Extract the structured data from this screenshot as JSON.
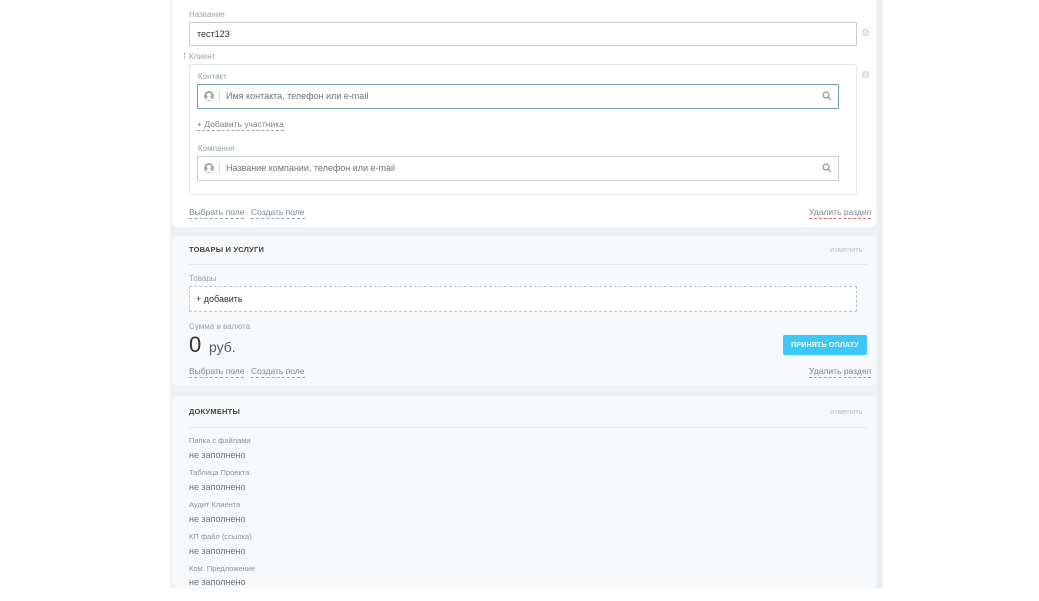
{
  "fields": {
    "name_label": "Название",
    "name_value": "тест123",
    "client_label": "Клиент",
    "contact_label": "Контакт",
    "contact_placeholder": "Имя контакта, телефон или e-mail",
    "add_participant": "+ Добавить участника",
    "company_label": "Компания",
    "company_placeholder": "Название компании, телефон или e-mail"
  },
  "section1_footer": {
    "choose_field": "Выбрать поле",
    "create_field": "Создать поле",
    "delete_section": "Удалить раздел"
  },
  "products": {
    "title": "ТОВАРЫ И УСЛУГИ",
    "edit": "изменить",
    "goods_label": "Товары",
    "add": "+ добавить",
    "sum_label": "Сумма и валюта",
    "amount": "0",
    "currency": "руб.",
    "pay_button": "ПРИНЯТЬ ОПЛАТУ",
    "choose_field": "Выбрать поле",
    "create_field": "Создать поле",
    "delete_section": "Удалить раздел"
  },
  "documents": {
    "title": "ДОКУМЕНТЫ",
    "edit": "изменить",
    "items": [
      {
        "label": "Папка с файлами",
        "value": "не заполнено"
      },
      {
        "label": "Таблица Проекта",
        "value": "не заполнено"
      },
      {
        "label": "Аудит Клиента",
        "value": "не заполнено"
      },
      {
        "label": "КП файл (ссылка)",
        "value": "не заполнено"
      },
      {
        "label": "Ком. Предложение",
        "value": "не заполнено"
      }
    ]
  },
  "icons": {
    "settings": "gear-icon",
    "search": "search-icon",
    "contact_avatar": "user-avatar-icon",
    "company_avatar": "company-avatar-icon"
  },
  "colors": {
    "accent_button": "#3bc8f5",
    "delete_underline": "#d86a6a",
    "focus_border": "#6aa2b4"
  }
}
